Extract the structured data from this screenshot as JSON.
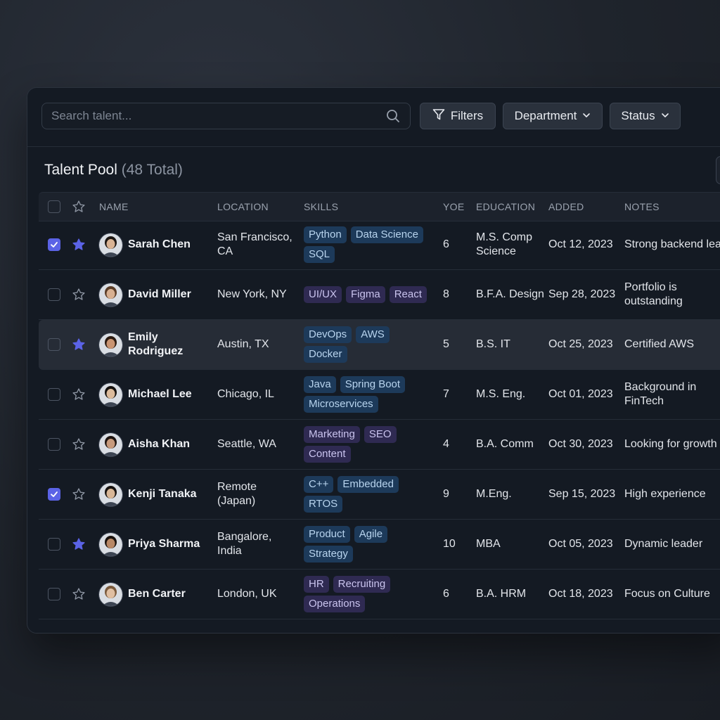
{
  "search": {
    "placeholder": "Search talent..."
  },
  "toolbar": {
    "filters_label": "Filters",
    "department_label": "Department",
    "status_label": "Status"
  },
  "table": {
    "title": "Talent Pool",
    "count": "(48 Total)",
    "columns": {
      "name": "NAME",
      "location": "LOCATION",
      "skills": "SKILLS",
      "yoe": "YOE",
      "education": "EDUCATION",
      "added": "ADDED",
      "notes": "NOTES"
    },
    "rows": [
      {
        "name": "Sarah Chen",
        "location": "San Francisco, CA",
        "skills": [
          {
            "label": "Python",
            "tone": "blue"
          },
          {
            "label": "Data Science",
            "tone": "blue"
          },
          {
            "label": "SQL",
            "tone": "blue"
          }
        ],
        "yoe": "6",
        "education": "M.S. Comp Science",
        "added": "Oct 12, 2023",
        "notes": "Strong backend lead",
        "checked": true,
        "starred": true,
        "skin": "#d9b394",
        "hair": "#1c1612"
      },
      {
        "name": "David Miller",
        "location": "New York, NY",
        "skills": [
          {
            "label": "UI/UX",
            "tone": "purple"
          },
          {
            "label": "Figma",
            "tone": "purple"
          },
          {
            "label": "React",
            "tone": "purple"
          }
        ],
        "yoe": "8",
        "education": "B.F.A. Design",
        "added": "Sep 28, 2023",
        "notes": "Portfolio is outstanding",
        "checked": false,
        "starred": false,
        "skin": "#d8b091",
        "hair": "#5a3c26"
      },
      {
        "name": "Emily Rodriguez",
        "location": "Austin, TX",
        "skills": [
          {
            "label": "DevOps",
            "tone": "blue"
          },
          {
            "label": "AWS",
            "tone": "blue"
          },
          {
            "label": "Docker",
            "tone": "blue"
          }
        ],
        "yoe": "5",
        "education": "B.S. IT",
        "added": "Oct 25, 2023",
        "notes": "Certified AWS",
        "checked": false,
        "starred": true,
        "skin": "#c99472",
        "hair": "#2b1a10"
      },
      {
        "name": "Michael Lee",
        "location": "Chicago, IL",
        "skills": [
          {
            "label": "Java",
            "tone": "blue"
          },
          {
            "label": "Spring Boot",
            "tone": "blue"
          },
          {
            "label": "Microservices",
            "tone": "blue"
          }
        ],
        "yoe": "7",
        "education": "M.S. Eng.",
        "added": "Oct 01, 2023",
        "notes": "Background in FinTech",
        "checked": false,
        "starred": false,
        "skin": "#dcbb9c",
        "hair": "#15110e"
      },
      {
        "name": "Aisha Khan",
        "location": "Seattle, WA",
        "skills": [
          {
            "label": "Marketing",
            "tone": "purple"
          },
          {
            "label": "SEO",
            "tone": "purple"
          },
          {
            "label": "Content",
            "tone": "purple"
          }
        ],
        "yoe": "4",
        "education": "B.A. Comm",
        "added": "Oct 30, 2023",
        "notes": "Looking for growth",
        "checked": false,
        "starred": false,
        "skin": "#c79a7c",
        "hair": "#1e1410"
      },
      {
        "name": "Kenji Tanaka",
        "location": "Remote (Japan)",
        "skills": [
          {
            "label": "C++",
            "tone": "blue"
          },
          {
            "label": "Embedded",
            "tone": "blue"
          },
          {
            "label": "RTOS",
            "tone": "blue"
          }
        ],
        "yoe": "9",
        "education": "M.Eng.",
        "added": "Sep 15, 2023",
        "notes": "High experience",
        "checked": true,
        "starred": false,
        "skin": "#d9b797",
        "hair": "#17120f"
      },
      {
        "name": "Priya Sharma",
        "location": "Bangalore, India",
        "skills": [
          {
            "label": "Product",
            "tone": "blue"
          },
          {
            "label": "Agile",
            "tone": "blue"
          },
          {
            "label": "Strategy",
            "tone": "blue"
          }
        ],
        "yoe": "10",
        "education": "MBA",
        "added": "Oct 05, 2023",
        "notes": "Dynamic leader",
        "checked": false,
        "starred": true,
        "skin": "#b88866",
        "hair": "#1a120d"
      },
      {
        "name": "Ben Carter",
        "location": "London, UK",
        "skills": [
          {
            "label": "HR",
            "tone": "purple"
          },
          {
            "label": "Recruiting",
            "tone": "purple"
          },
          {
            "label": "Operations",
            "tone": "purple"
          }
        ],
        "yoe": "6",
        "education": "B.A. HRM",
        "added": "Oct 18, 2023",
        "notes": "Focus on Culture",
        "checked": false,
        "starred": false,
        "skin": "#e0bfa2",
        "hair": "#7a5a3c"
      }
    ]
  },
  "colors": {
    "accent": "#5b63e6",
    "tag_blue": "#1d3a5a",
    "tag_purple": "#2f2a52",
    "highlight_row": "#262c36"
  },
  "icons": {
    "search": "search-icon",
    "filter": "filter-icon",
    "chevron": "chevron-down-icon",
    "star": "star-icon",
    "check": "check-icon"
  }
}
